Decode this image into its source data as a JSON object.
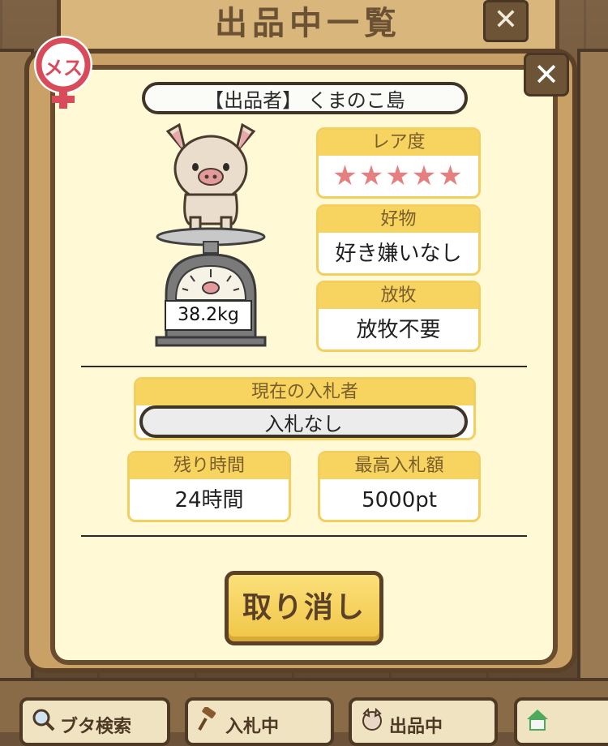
{
  "screen": {
    "title": "出品中一覧",
    "close_glyph": "✕"
  },
  "gender_badge": {
    "label": "メス",
    "color": "#d94a5a"
  },
  "listing": {
    "seller": "【出品者】 くまのこ島",
    "weight": "38.2kg",
    "rarity_label": "レア度",
    "rarity_stars": "★★★★★",
    "favorite_label": "好物",
    "favorite_value": "好き嫌いなし",
    "grazing_label": "放牧",
    "grazing_value": "放牧不要",
    "current_bidder_label": "現在の入札者",
    "current_bidder_value": "入札なし",
    "time_left_label": "残り時間",
    "time_left_value": "24時間",
    "max_bid_label": "最高入札額",
    "max_bid_value": "5000pt"
  },
  "cancel_label": "取り消し",
  "bottom_nav": [
    {
      "label": "ブタ検索",
      "icon": "magnifier-icon"
    },
    {
      "label": "入札中",
      "icon": "gavel-icon"
    },
    {
      "label": "出品中",
      "icon": "pig-icon"
    },
    {
      "label": "",
      "icon": "home-icon"
    }
  ],
  "colors": {
    "accent_yellow": "#f7d45f",
    "panel_bg": "#fff9d6",
    "frame_brown": "#5a4128",
    "star_pink": "#e67f7f"
  }
}
